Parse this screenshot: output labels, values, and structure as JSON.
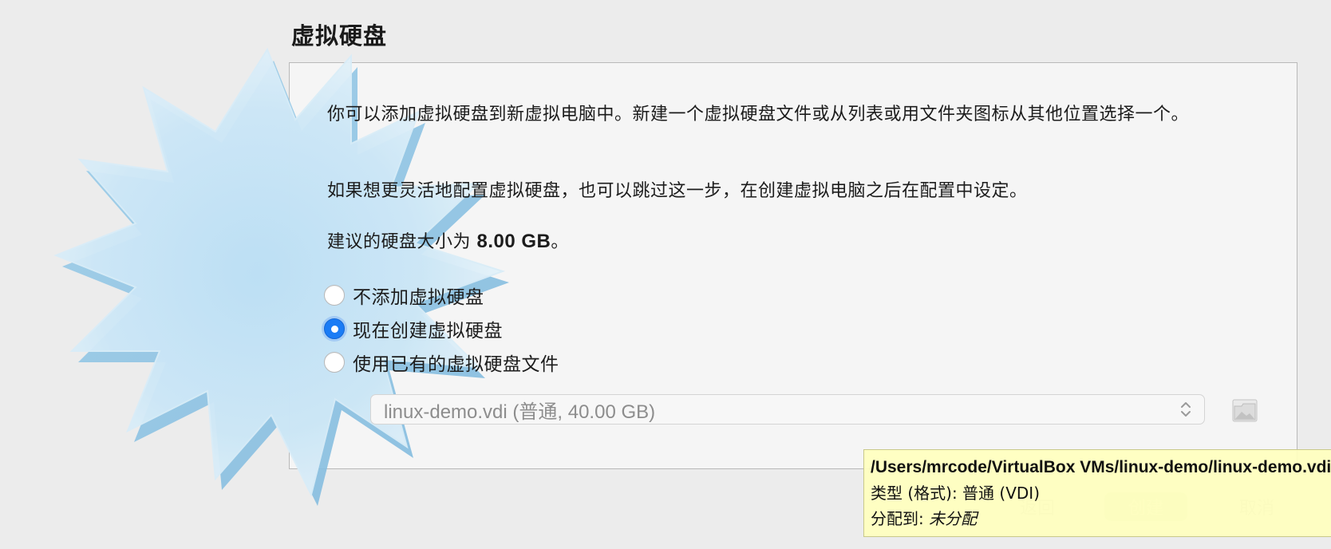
{
  "page": {
    "title": "虚拟硬盘"
  },
  "info": {
    "paragraph1": "你可以添加虚拟硬盘到新虚拟电脑中。新建一个虚拟硬盘文件或从列表或用文件夹图标从其他位置选择一个。",
    "paragraph2": "如果想更灵活地配置虚拟硬盘，也可以跳过这一步，在创建虚拟电脑之后在配置中设定。",
    "recommended_prefix": "建议的硬盘大小为 ",
    "recommended_size": "8.00 GB",
    "recommended_suffix": "。"
  },
  "options": [
    {
      "label": "不添加虚拟硬盘",
      "selected": false
    },
    {
      "label": "现在创建虚拟硬盘",
      "selected": true
    },
    {
      "label": "使用已有的虚拟硬盘文件",
      "selected": false
    }
  ],
  "disk_selector": {
    "value": "linux-demo.vdi (普通, 40.00 GB)",
    "icon": "folder-icon"
  },
  "footer": {
    "back_label": "返回",
    "create_label": "创建",
    "cancel_label": "取消"
  },
  "tooltip": {
    "path": "/Users/mrcode/VirtualBox VMs/linux-demo/linux-demo.vdi",
    "type_line": "类型 (格式):  普通 (VDI)",
    "alloc_label": "分配到: ",
    "alloc_value": "未分配"
  },
  "colors": {
    "accent": "#1b7cf5",
    "tooltip_bg": "#ffffbe"
  }
}
